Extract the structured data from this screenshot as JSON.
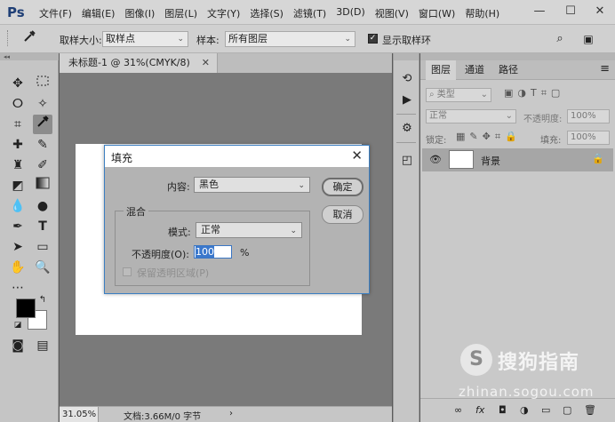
{
  "app": {
    "logo": "Ps"
  },
  "menu": [
    "文件(F)",
    "编辑(E)",
    "图像(I)",
    "图层(L)",
    "文字(Y)",
    "选择(S)",
    "滤镜(T)",
    "3D(D)",
    "视图(V)",
    "窗口(W)",
    "帮助(H)"
  ],
  "window_controls": {
    "minimize": "—",
    "maximize": "☐",
    "close": "✕"
  },
  "options": {
    "sample_size_label": "取样大小:",
    "sample_size_value": "取样点",
    "sample_label": "样本:",
    "sample_value": "所有图层",
    "show_ring_label": "显示取样环"
  },
  "document": {
    "tab_title": "未标题-1 @ 31%(CMYK/8)",
    "zoom": "31.05%",
    "doc_info": "文档:3.66M/0 字节"
  },
  "layers_panel": {
    "tabs": [
      "图层",
      "通道",
      "路径"
    ],
    "filter_placeholder": "类型",
    "blend_mode": "正常",
    "opacity_label": "不透明度:",
    "opacity_value": "100%",
    "lock_label": "锁定:",
    "fill_label": "填充:",
    "fill_value": "100%",
    "layer_name": "背景",
    "footer_icons": [
      "∞",
      "fx",
      "◘",
      "◑",
      "▭",
      "▢",
      "🗑"
    ]
  },
  "dialog": {
    "title": "填充",
    "close": "✕",
    "content_label": "内容:",
    "content_value": "黑色",
    "ok_label": "确定",
    "cancel_label": "取消",
    "blend_group_title": "混合",
    "mode_label": "模式:",
    "mode_value": "正常",
    "opacity_label": "不透明度(O):",
    "opacity_value": "100",
    "opacity_unit": "%",
    "preserve_label": "保留透明区域(P)"
  },
  "colors": {
    "foreground": "#000000",
    "background": "#ffffff",
    "dialog_border": "#3c7fc1"
  },
  "watermark": {
    "brand": "搜狗指南",
    "url": "zhinan.sogou.com",
    "logo_letter": "S"
  }
}
